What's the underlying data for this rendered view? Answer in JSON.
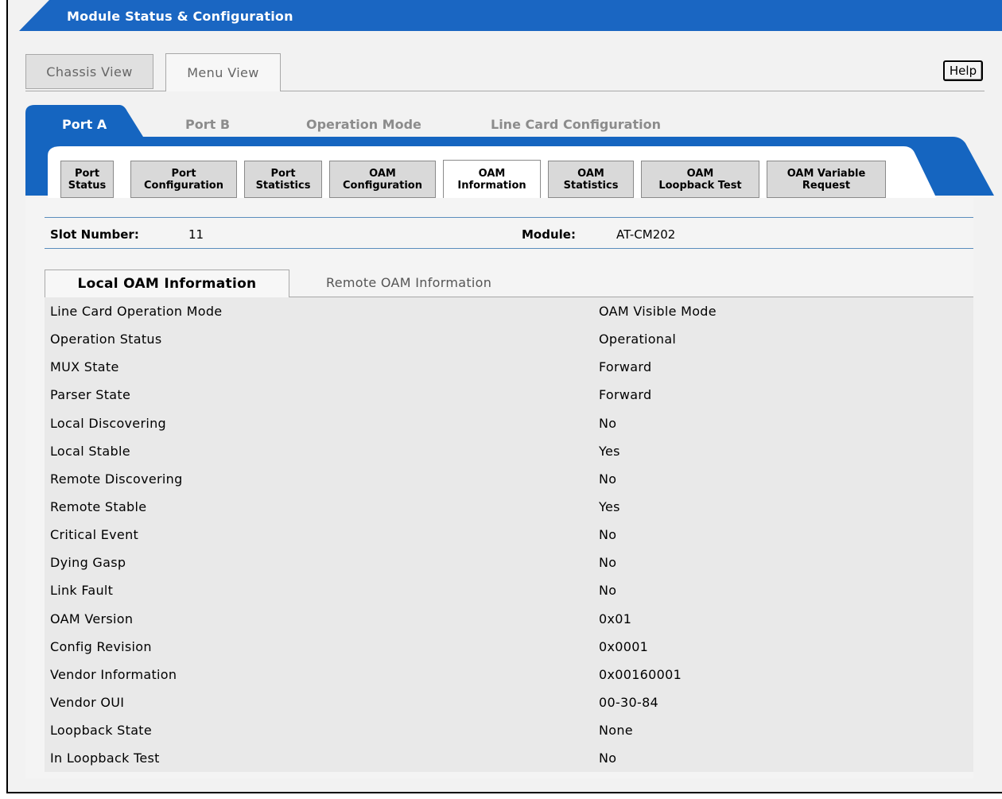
{
  "window": {
    "title": "Module Status & Configuration"
  },
  "view_tabs": [
    {
      "label": "Chassis View",
      "active": false
    },
    {
      "label": "Menu View",
      "active": true
    }
  ],
  "help_label": "Help",
  "main_tabs": [
    {
      "label": "Port A",
      "active": true
    },
    {
      "label": "Port B",
      "active": false
    },
    {
      "label": "Operation Mode",
      "active": false
    },
    {
      "label": "Line Card Configuration",
      "active": false
    }
  ],
  "sub_tabs": [
    {
      "line1": "Port",
      "line2": "Status",
      "active": false
    },
    {
      "line1": "Port",
      "line2": "Configuration",
      "active": false
    },
    {
      "line1": "Port",
      "line2": "Statistics",
      "active": false
    },
    {
      "line1": "OAM",
      "line2": "Configuration",
      "active": false
    },
    {
      "line1": "OAM",
      "line2": "Information",
      "active": true
    },
    {
      "line1": "OAM",
      "line2": "Statistics",
      "active": false
    },
    {
      "line1": "OAM",
      "line2": "Loopback Test",
      "active": false
    },
    {
      "line1": "OAM Variable",
      "line2": "Request",
      "active": false
    }
  ],
  "slot": {
    "label": "Slot Number:",
    "value": "11"
  },
  "module": {
    "label": "Module:",
    "value": "AT-CM202"
  },
  "info_tabs": [
    {
      "label": "Local OAM Information",
      "active": true
    },
    {
      "label": "Remote OAM Information",
      "active": false
    }
  ],
  "oam_info": [
    {
      "label": "Line Card Operation Mode",
      "value": "OAM Visible Mode"
    },
    {
      "label": "Operation Status",
      "value": "Operational"
    },
    {
      "label": "MUX State",
      "value": "Forward"
    },
    {
      "label": "Parser State",
      "value": "Forward"
    },
    {
      "label": "Local Discovering",
      "value": "No"
    },
    {
      "label": "Local Stable",
      "value": "Yes"
    },
    {
      "label": "Remote Discovering",
      "value": "No"
    },
    {
      "label": "Remote Stable",
      "value": "Yes"
    },
    {
      "label": "Critical Event",
      "value": "No"
    },
    {
      "label": "Dying Gasp",
      "value": "No"
    },
    {
      "label": "Link Fault",
      "value": "No"
    },
    {
      "label": "OAM Version",
      "value": "0x01"
    },
    {
      "label": "Config Revision",
      "value": "0x0001"
    },
    {
      "label": "Vendor Information",
      "value": "0x00160001"
    },
    {
      "label": "Vendor OUI",
      "value": "00-30-84"
    },
    {
      "label": "Loopback State",
      "value": "None"
    },
    {
      "label": "In Loopback Test",
      "value": "No"
    }
  ],
  "colors": {
    "accent_blue": "#1565c0",
    "title_blue": "#1a66c2"
  }
}
